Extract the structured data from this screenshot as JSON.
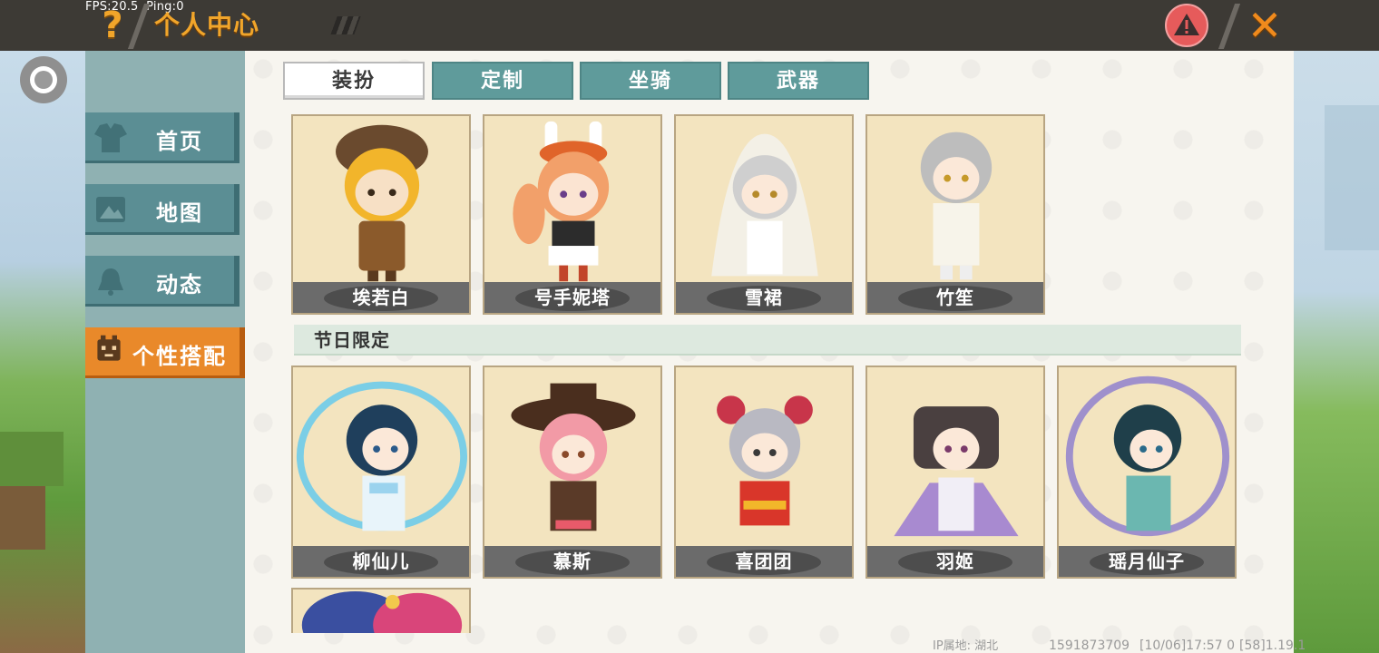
{
  "status": {
    "fps": "FPS:20.5",
    "ping": "Ping:0"
  },
  "header": {
    "title": "个人中心"
  },
  "sidebar": {
    "items": [
      {
        "label": "首页",
        "icon": "shirt-icon"
      },
      {
        "label": "地图",
        "icon": "map-icon"
      },
      {
        "label": "动态",
        "icon": "bell-icon"
      },
      {
        "label": "个性搭配",
        "icon": "avatar-icon",
        "active": true
      }
    ]
  },
  "tabs": [
    {
      "label": "装扮",
      "active": true
    },
    {
      "label": "定制"
    },
    {
      "label": "坐骑"
    },
    {
      "label": "武器"
    }
  ],
  "outfits_row1": [
    {
      "name": "埃若白"
    },
    {
      "name": "号手妮塔"
    },
    {
      "name": "雪裙"
    },
    {
      "name": "竹笙"
    }
  ],
  "section": {
    "title": "节日限定"
  },
  "outfits_row2": [
    {
      "name": "柳仙儿"
    },
    {
      "name": "慕斯"
    },
    {
      "name": "喜团团"
    },
    {
      "name": "羽姬"
    },
    {
      "name": "瑶月仙子"
    }
  ],
  "footer": {
    "ip_location": "IP属地: 湖北",
    "uid": "1591873709",
    "timestamp": "[10/06]17:57 0",
    "version": "[58]1.19.1"
  },
  "colors": {
    "accent_orange": "#e9892a",
    "teal": "#5f9b9b",
    "topbar": "#3d3a35"
  }
}
